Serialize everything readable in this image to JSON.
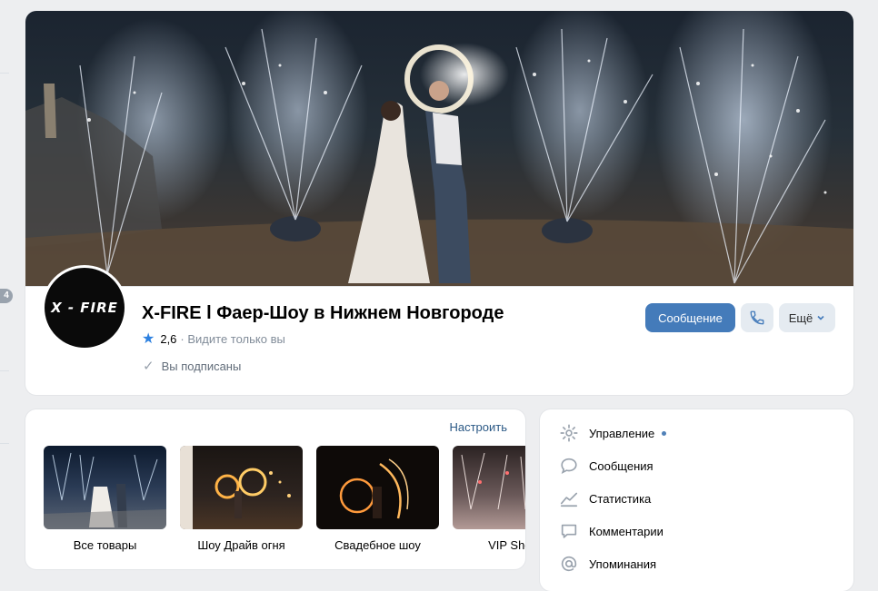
{
  "left_rail": {
    "badge": "4"
  },
  "group": {
    "title": "X-FIRE l Фаер-Шоу в Нижнем Новгороде",
    "avatar_text": "X - FIRE",
    "rating": "2,6",
    "rating_visibility": "· Видите только вы",
    "subscribed": "Вы подписаны"
  },
  "actions": {
    "message": "Сообщение",
    "more": "Ещё"
  },
  "goods": {
    "settings": "Настроить",
    "items": [
      {
        "label": "Все товары"
      },
      {
        "label": "Шоу Драйв огня"
      },
      {
        "label": "Свадебное шоу"
      },
      {
        "label": "VIP Show"
      }
    ]
  },
  "menu": {
    "items": [
      {
        "label": "Управление",
        "icon": "gear-icon"
      },
      {
        "label": "Сообщения",
        "icon": "message-bubble-icon"
      },
      {
        "label": "Статистика",
        "icon": "stats-chart-icon"
      },
      {
        "label": "Комментарии",
        "icon": "comment-icon"
      },
      {
        "label": "Упоминания",
        "icon": "at-sign-icon"
      }
    ]
  },
  "colors": {
    "accent": "#447bba",
    "link": "#2a5885",
    "badge": "#99a2ad"
  }
}
